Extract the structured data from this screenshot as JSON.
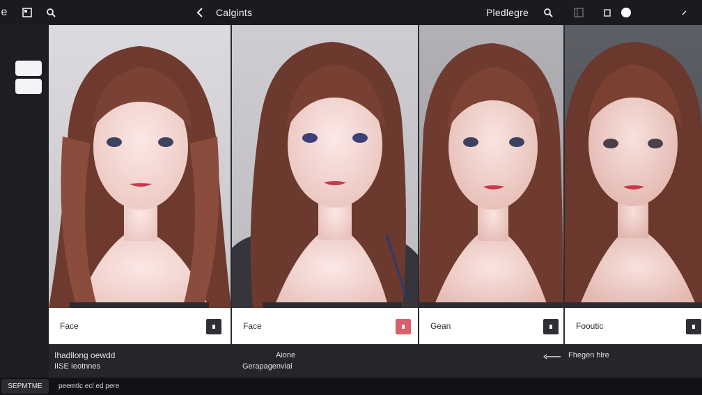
{
  "topbar": {
    "left_glyph": "e",
    "center_title": "Calgints",
    "right_title": "Pledlegre",
    "icons": [
      "window-icon",
      "search-icon",
      "back-chevron-icon",
      "search-icon",
      "panel-icon",
      "small-square-icon",
      "status-dot-icon",
      "minimize-icon"
    ]
  },
  "gallery": {
    "cards": [
      {
        "caption": "Face",
        "button_color": "#2f3036"
      },
      {
        "caption": "Face",
        "button_color": "#d9606a"
      },
      {
        "caption": "Gean",
        "button_color": "#2f3036"
      },
      {
        "caption": "Fooutic",
        "button_color": "#2f3036"
      }
    ]
  },
  "infostrip": {
    "left_title": "Ihadllong oewdd",
    "left_sub": "IISE Ieotnnes",
    "center_title": "Aione",
    "center_sub": "Gerapagenvial",
    "right_label": "Fhegen hlre"
  },
  "statusbar": {
    "chip": "SEPMTME",
    "text": "peemtlc ecl ed pere"
  },
  "colors": {
    "background": "#1c1d21",
    "caption_bg": "#ffffff",
    "accent": "#d9606a"
  }
}
